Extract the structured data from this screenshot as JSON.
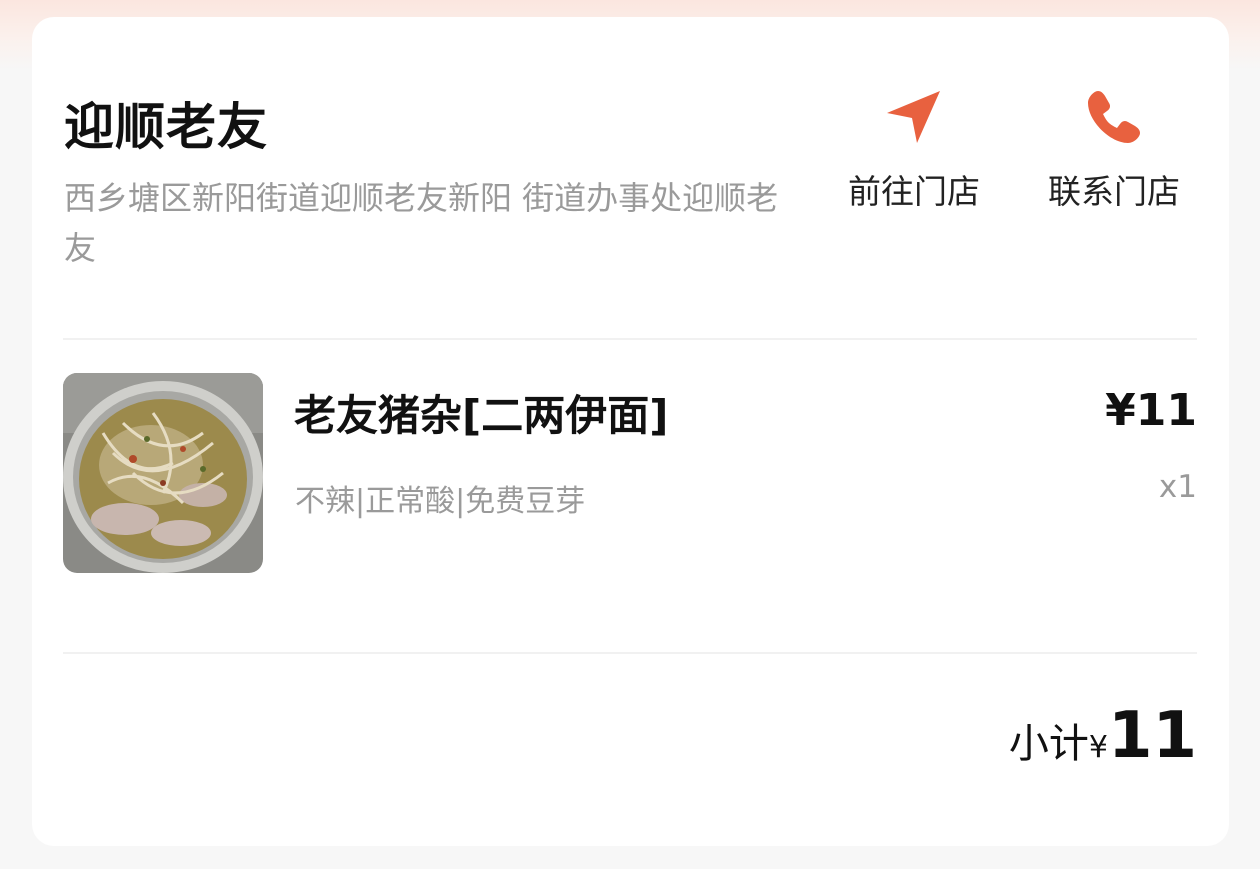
{
  "store": {
    "name": "迎顺老友",
    "address": "西乡塘区新阳街道迎顺老友新阳 街道办事处迎顺老友"
  },
  "actions": {
    "navigate": {
      "label": "前往门店",
      "icon": "navigation-arrow-icon"
    },
    "call": {
      "label": "联系门店",
      "icon": "phone-icon"
    }
  },
  "accent_color": "#e8613f",
  "item": {
    "name": "老友猪杂[二两伊面]",
    "options": "不辣|正常酸|免费豆芽",
    "price": "¥11",
    "quantity": "x1",
    "image": "noodle-soup-thumbnail"
  },
  "subtotal": {
    "label": "小计",
    "currency": "¥",
    "amount": "11"
  }
}
